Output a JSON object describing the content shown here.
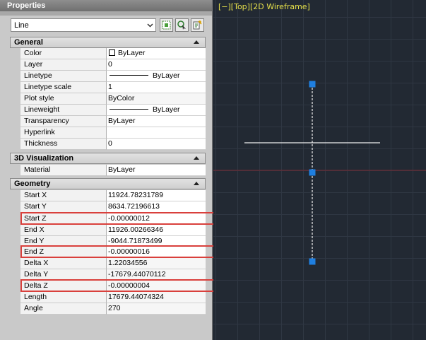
{
  "palette": {
    "title": "Properties",
    "object_type": "Line",
    "tool_buttons": [
      "toggle-pickadd-icon",
      "select-objects-icon",
      "quick-select-icon"
    ]
  },
  "sections": {
    "general": {
      "title": "General",
      "rows": [
        {
          "name": "Color",
          "value": "ByLayer"
        },
        {
          "name": "Layer",
          "value": "0"
        },
        {
          "name": "Linetype",
          "value": "ByLayer"
        },
        {
          "name": "Linetype scale",
          "value": "1"
        },
        {
          "name": "Plot style",
          "value": "ByColor"
        },
        {
          "name": "Lineweight",
          "value": "ByLayer"
        },
        {
          "name": "Transparency",
          "value": "ByLayer"
        },
        {
          "name": "Hyperlink",
          "value": ""
        },
        {
          "name": "Thickness",
          "value": "0"
        }
      ]
    },
    "visualization": {
      "title": "3D Visualization",
      "rows": [
        {
          "name": "Material",
          "value": "ByLayer"
        }
      ]
    },
    "geometry": {
      "title": "Geometry",
      "rows": [
        {
          "name": "Start X",
          "value": "11924.78231789"
        },
        {
          "name": "Start Y",
          "value": "8634.72196613"
        },
        {
          "name": "Start Z",
          "value": "-0.00000012"
        },
        {
          "name": "End X",
          "value": "11926.00266346"
        },
        {
          "name": "End Y",
          "value": "-9044.71873499"
        },
        {
          "name": "End Z",
          "value": "-0.00000016"
        },
        {
          "name": "Delta X",
          "value": "1.22034556"
        },
        {
          "name": "Delta Y",
          "value": "-17679.44070112"
        },
        {
          "name": "Delta Z",
          "value": "-0.00000004"
        },
        {
          "name": "Length",
          "value": "17679.44074324"
        },
        {
          "name": "Angle",
          "value": "270"
        }
      ]
    }
  },
  "viewport": {
    "label": "[−][Top][2D Wireframe]"
  },
  "colors": {
    "highlight": "#d9403c",
    "grip": "#1f7fe0",
    "viewport_bg": "#222933",
    "viewport_label": "#e6e04a"
  }
}
